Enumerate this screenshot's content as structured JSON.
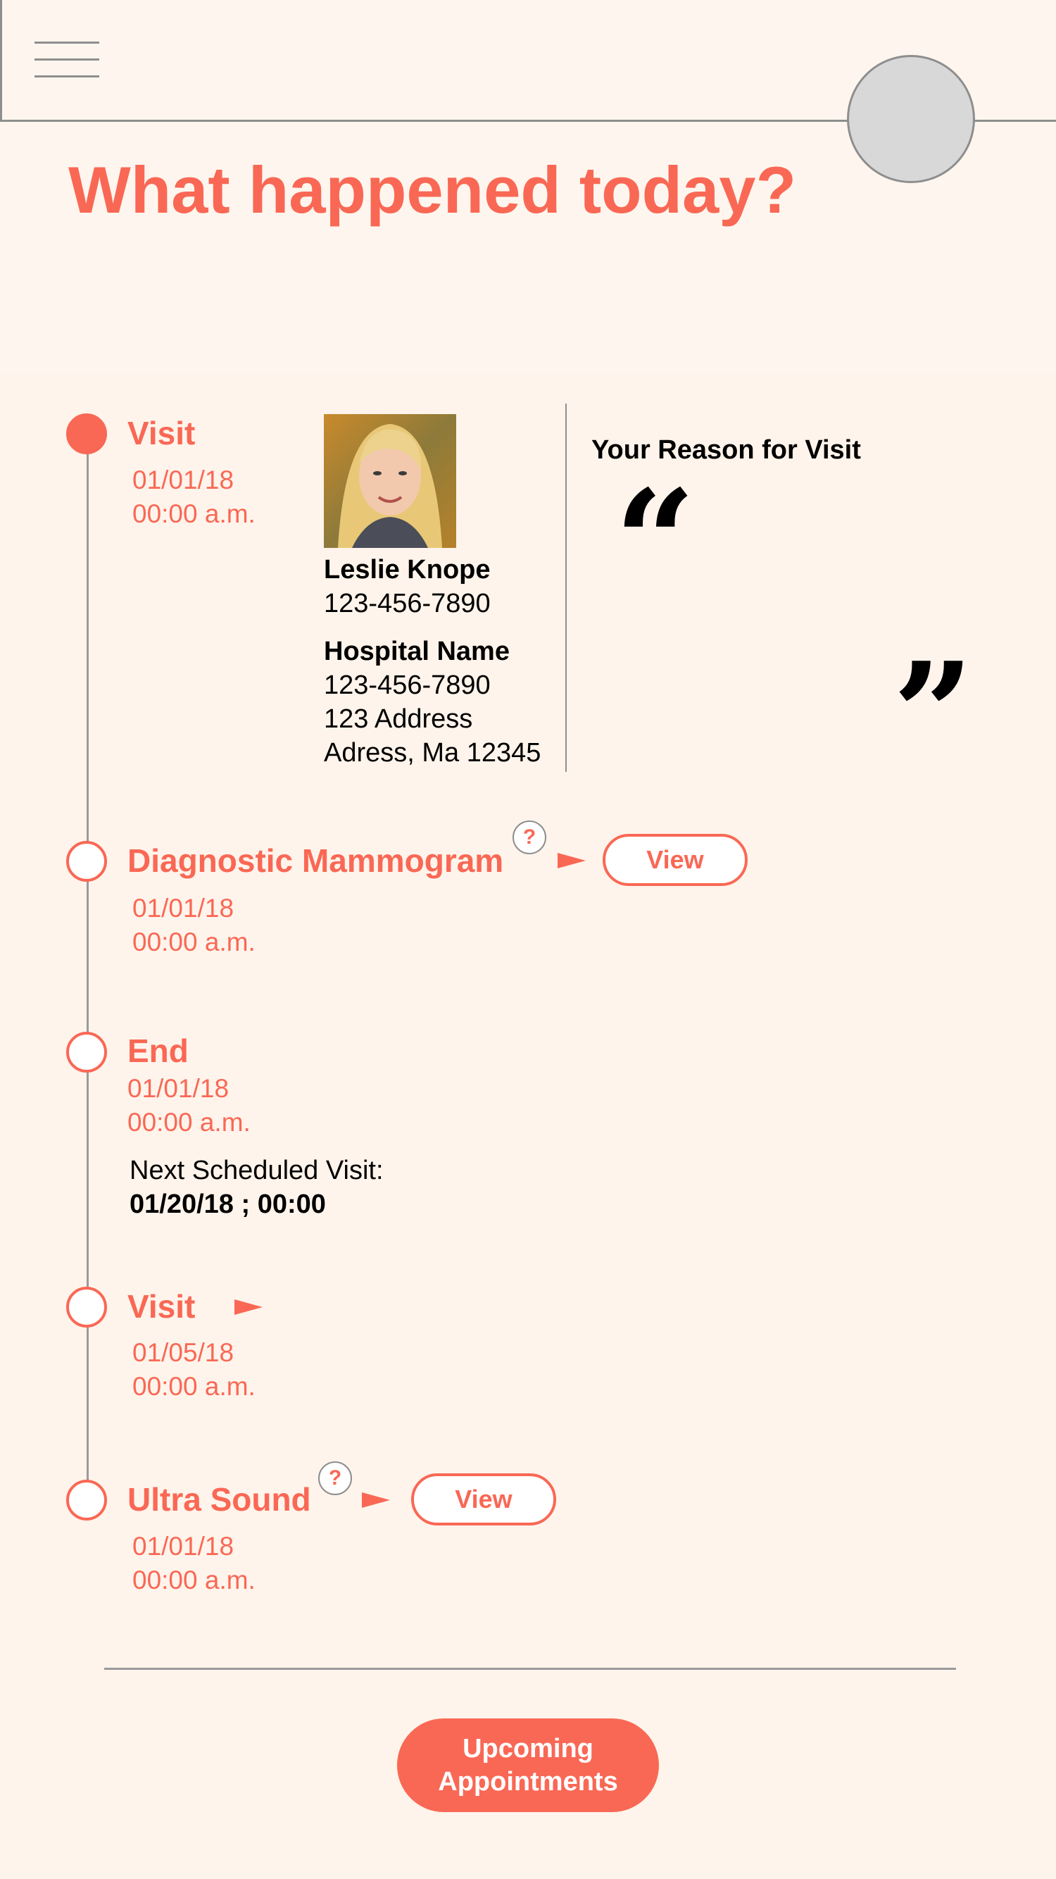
{
  "header": {
    "menu_icon": "hamburger-menu-icon",
    "avatar_icon": "profile-avatar"
  },
  "page_title": "What happened today?",
  "timeline": {
    "visit": {
      "title": "Visit",
      "date": "01/01/18",
      "time": "00:00 a.m.",
      "provider_name": "Leslie Knope",
      "provider_phone": "123-456-7890",
      "hospital_name": "Hospital Name",
      "hospital_phone": "123-456-7890",
      "address_line1": "123 Address",
      "address_line2": "Adress, Ma 12345",
      "reason_label": "Your Reason for Visit",
      "open_quote": "“",
      "close_quote": "”"
    },
    "mammogram": {
      "title": "Diagnostic Mammogram",
      "help": "?",
      "view_label": "View",
      "date": "01/01/18",
      "time": "00:00 a.m."
    },
    "end": {
      "title": "End",
      "date": "01/01/18",
      "time": "00:00 a.m.",
      "next_label": "Next Scheduled Visit:",
      "next_value": "01/20/18 ; 00:00"
    },
    "visit2": {
      "title": "Visit",
      "date": "01/05/18",
      "time": "00:00 a.m."
    },
    "ultrasound": {
      "title": "Ultra Sound",
      "help": "?",
      "view_label": "View",
      "date": "01/01/18",
      "time": "00:00 a.m."
    }
  },
  "footer": {
    "upcoming_line1": "Upcoming",
    "upcoming_line2": "Appointments"
  },
  "colors": {
    "accent": "#f96855",
    "background": "#fef6ee",
    "panel": "#fff4eb",
    "border": "#8e8e8e"
  }
}
